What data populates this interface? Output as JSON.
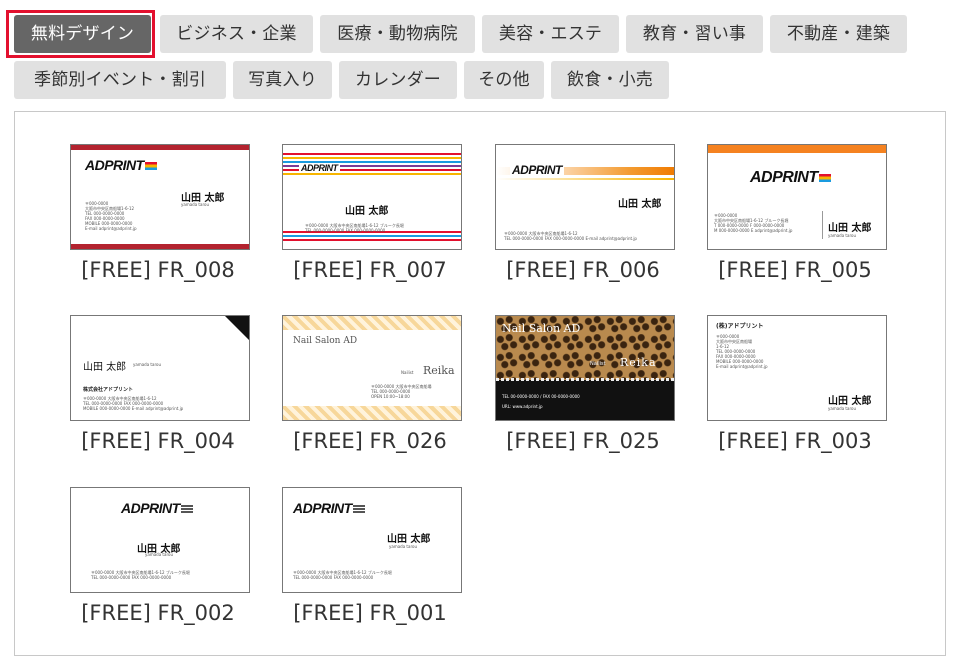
{
  "categories": [
    {
      "label": "無料デザイン",
      "active": true
    },
    {
      "label": "ビジネス・企業"
    },
    {
      "label": "医療・動物病院"
    },
    {
      "label": "美容・エステ"
    },
    {
      "label": "教育・習い事"
    },
    {
      "label": "不動産・建築"
    },
    {
      "label": "季節別イベント・割引"
    },
    {
      "label": "写真入り"
    },
    {
      "label": "カレンダー"
    },
    {
      "label": "その他"
    },
    {
      "label": "飲食・小売"
    }
  ],
  "templates": [
    {
      "title": "[FREE] FR_008",
      "logo": "ADPRINT",
      "name": "山田 太郎",
      "romaji": "yamada tarou"
    },
    {
      "title": "[FREE] FR_007",
      "logo": "ADPRINT",
      "name": "山田 太郎"
    },
    {
      "title": "[FREE] FR_006",
      "logo": "ADPRINT",
      "name": "山田 太郎"
    },
    {
      "title": "[FREE] FR_005",
      "logo": "ADPRINT",
      "name": "山田 太郎",
      "romaji": "yamada tarou"
    },
    {
      "title": "[FREE] FR_004",
      "name": "山田 太郎",
      "romaji": "yamada tarou",
      "company": "株式会社アドプリント"
    },
    {
      "title": "[FREE] FR_026",
      "shop": "Nail Salon AD",
      "role": "Nailist",
      "name": "Reika"
    },
    {
      "title": "[FREE] FR_025",
      "shop": "Nail Salon AD",
      "role": "Nailist",
      "name": "Reika",
      "tel": "TEL 00-0000-0000 / FAX 00-0000-0000",
      "url": "URL: www.adprint.jp"
    },
    {
      "title": "[FREE] FR_003",
      "company": "(株)アドプリント",
      "name": "山田 太郎",
      "romaji": "yamada tarou"
    },
    {
      "title": "[FREE] FR_002",
      "logo": "ADPRINT",
      "name": "山田 太郎",
      "romaji": "yamada tarou"
    },
    {
      "title": "[FREE] FR_001",
      "logo": "ADPRINT",
      "name": "山田 太郎",
      "romaji": "yamada tarou"
    }
  ],
  "colors": {
    "accent_red": "#e3102e",
    "tag_bg": "#e1e1e1",
    "tag_active_bg": "#666666"
  }
}
